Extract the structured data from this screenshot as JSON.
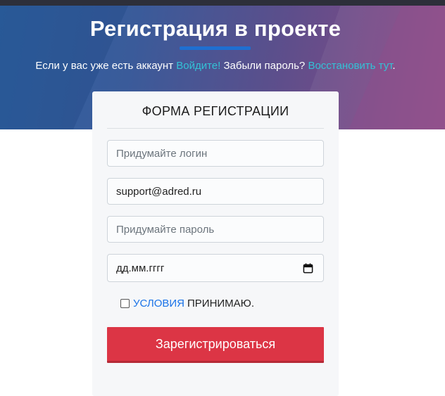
{
  "header": {
    "title": "Регистрация в проекте",
    "subtitle_prefix": "Если у вас уже есть аккаунт ",
    "login_link": "Войдите!",
    "forgot_text": " Забыли пароль? ",
    "restore_link": "Восстановить тут",
    "subtitle_suffix": "."
  },
  "form": {
    "title": "ФОРМА РЕГИСТРАЦИИ",
    "login_placeholder": "Придумайте логин",
    "email_value": "support@adred.ru",
    "password_placeholder": "Придумайте пароль",
    "date_placeholder": "дд.мм.гггг",
    "terms_link": "УСЛОВИЯ",
    "terms_text": "ПРИНИМАЮ.",
    "submit_label": "Зарегистрироваться"
  },
  "icons": {
    "date": "calendar-icon"
  },
  "colors": {
    "accent": "#dc3545",
    "link": "#1a73e8",
    "hero_link": "#33c2d6",
    "underline": "#1f6fd1"
  }
}
